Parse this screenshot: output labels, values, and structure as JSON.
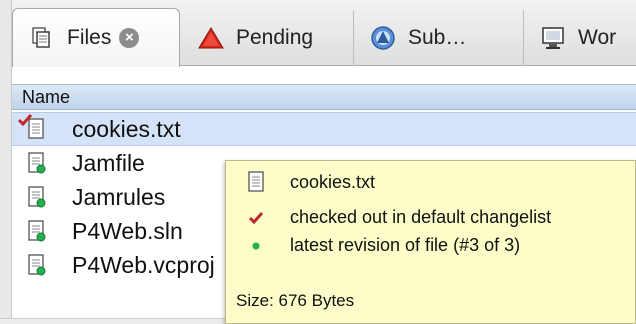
{
  "tabs": [
    {
      "label": "Files",
      "icon": "files-icon",
      "active": true,
      "closable": true
    },
    {
      "label": "Pending",
      "icon": "warning-triangle-icon",
      "active": false
    },
    {
      "label": "Sub…",
      "icon": "submitted-icon",
      "active": false
    },
    {
      "label": "Wor",
      "icon": "workspace-monitor-icon",
      "active": false
    }
  ],
  "column_header": "Name",
  "files": [
    {
      "name": "cookies.txt",
      "checked_out": true,
      "selected": true
    },
    {
      "name": "Jamfile",
      "checked_out": false
    },
    {
      "name": "Jamrules",
      "checked_out": false
    },
    {
      "name": "P4Web.sln",
      "checked_out": false
    },
    {
      "name": "P4Web.vcproj",
      "checked_out": false
    }
  ],
  "tooltip": {
    "filename": "cookies.txt",
    "status": "checked out in default changelist",
    "revision": "latest revision of file (#3 of 3)",
    "size": "Size: 676 Bytes"
  },
  "colors": {
    "selection": "#d4e3f7",
    "tooltip_bg": "#fdfdc9",
    "check_red": "#c0292b",
    "dot_green": "#22b14c"
  }
}
